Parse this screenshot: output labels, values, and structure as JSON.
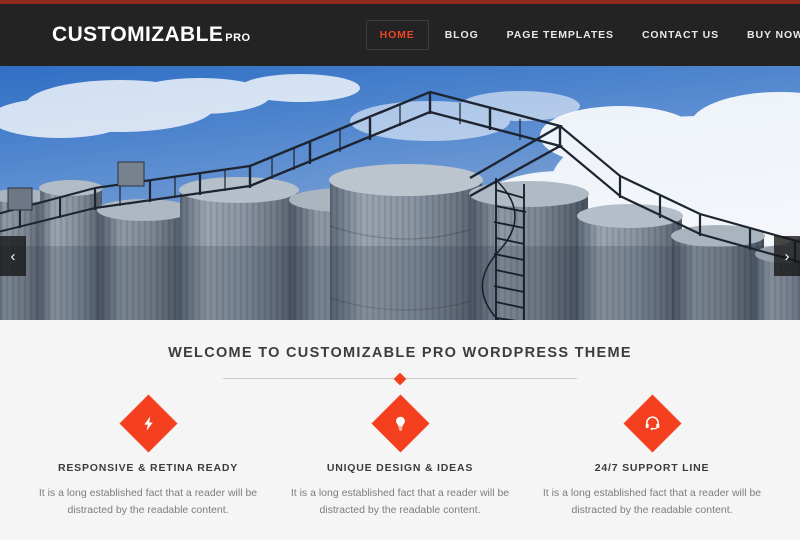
{
  "site": {
    "logo_main": "CUSTOMIZABLE",
    "logo_suffix": "PRO",
    "accent_color": "#f4401f",
    "header_bg": "#232323",
    "top_accent_color": "#8e2a1c"
  },
  "nav": {
    "items": [
      {
        "label": "HOME",
        "active": true
      },
      {
        "label": "BLOG",
        "active": false
      },
      {
        "label": "PAGE TEMPLATES",
        "active": false
      },
      {
        "label": "CONTACT US",
        "active": false
      },
      {
        "label": "BUY NOW",
        "active": false
      }
    ]
  },
  "search": {
    "value": "",
    "placeholder": "",
    "icon": "search-icon"
  },
  "hero": {
    "alt": "Industrial grain silos with metal walkways against a blue cloudy sky",
    "prev_label": "‹",
    "next_label": "›"
  },
  "welcome": {
    "title": "WELCOME TO CUSTOMIZABLE PRO WORDPRESS THEME"
  },
  "features": [
    {
      "icon": "lightning-bolt-icon",
      "title": "RESPONSIVE & RETINA READY",
      "text": "It is a long established fact that a reader will be distracted by the readable content."
    },
    {
      "icon": "lightbulb-icon",
      "title": "UNIQUE DESIGN & IDEAS",
      "text": "It is a long established fact that a reader will be distracted by the readable content."
    },
    {
      "icon": "headset-support-icon",
      "title": "24/7 SUPPORT LINE",
      "text": "It is a long established fact that a reader will be distracted by the readable content."
    }
  ]
}
